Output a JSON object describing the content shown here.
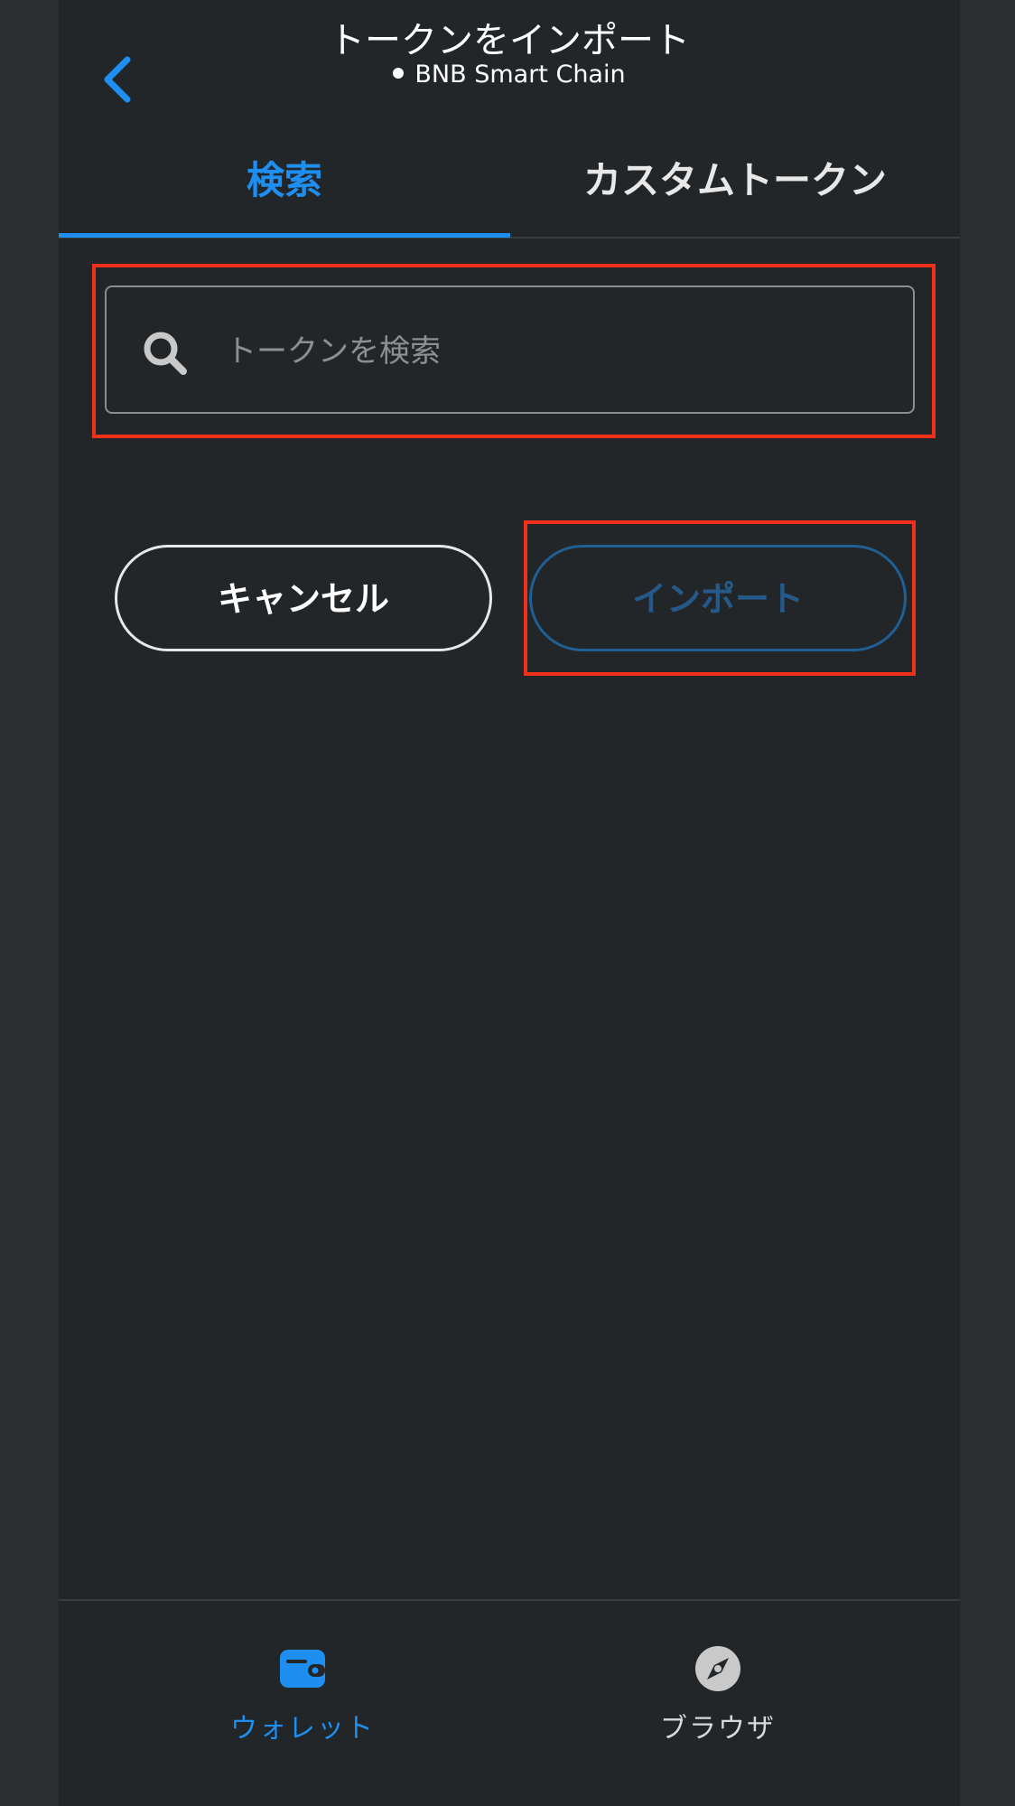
{
  "header": {
    "title": "トークンをインポート",
    "network": "BNB Smart Chain",
    "back_icon": "chevron-left-icon"
  },
  "tabs": [
    {
      "label": "検索",
      "active": true
    },
    {
      "label": "カスタムトークン",
      "active": false
    }
  ],
  "search": {
    "placeholder": "トークンを検索",
    "value": "",
    "icon": "search-icon"
  },
  "actions": {
    "cancel_label": "キャンセル",
    "import_label": "インポート"
  },
  "bottom_nav": [
    {
      "label": "ウォレット",
      "icon": "wallet-icon",
      "active": true
    },
    {
      "label": "ブラウザ",
      "icon": "compass-icon",
      "active": false
    }
  ],
  "colors": {
    "accent": "#1e8ff0",
    "background": "#232629",
    "highlight": "#f0301a",
    "disabled_button": "#24598a"
  }
}
